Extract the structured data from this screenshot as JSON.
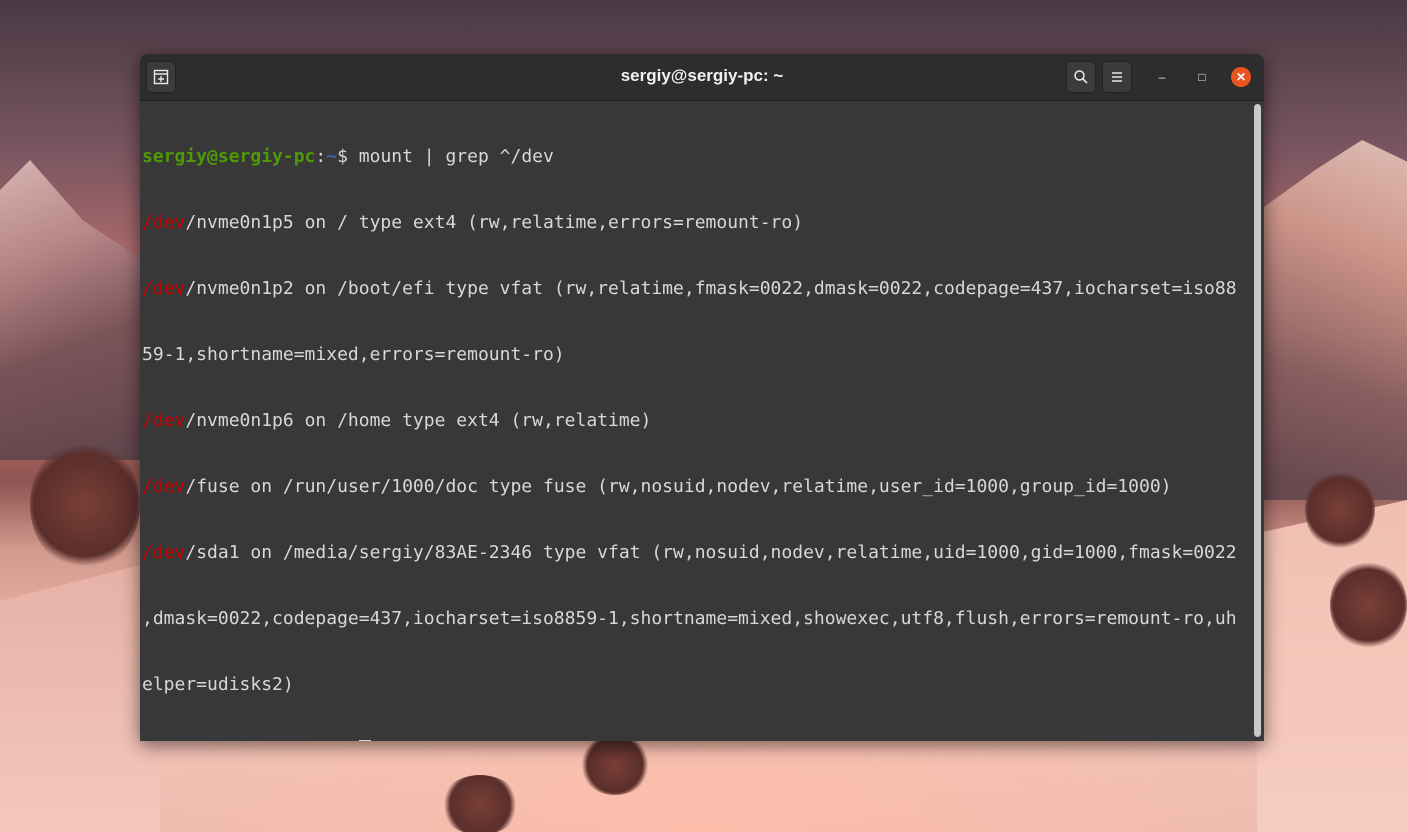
{
  "window": {
    "title": "sergiy@sergiy-pc: ~",
    "buttons": {
      "new_tab_icon": "new-tab-icon",
      "search_icon": "search-icon",
      "menu_icon": "hamburger-menu-icon",
      "minimize_glyph": "–",
      "maximize_glyph": "□",
      "close_glyph": "✕"
    }
  },
  "terminal": {
    "prompt": {
      "user_host": "sergiy@sergiy-pc",
      "sep": ":",
      "path": "~",
      "dollar": "$ "
    },
    "command": "mount | grep ^/dev",
    "output": [
      {
        "match": "/dev",
        "rest": "/nvme0n1p5 on / type ext4 (rw,relatime,errors=remount-ro)"
      },
      {
        "match": "/dev",
        "rest": "/nvme0n1p2 on /boot/efi type vfat (rw,relatime,fmask=0022,dmask=0022,codepage=437,iocharset=iso88"
      },
      {
        "match": "",
        "rest": "59-1,shortname=mixed,errors=remount-ro)"
      },
      {
        "match": "/dev",
        "rest": "/nvme0n1p6 on /home type ext4 (rw,relatime)"
      },
      {
        "match": "/dev",
        "rest": "/fuse on /run/user/1000/doc type fuse (rw,nosuid,nodev,relatime,user_id=1000,group_id=1000)"
      },
      {
        "match": "/dev",
        "rest": "/sda1 on /media/sergiy/83AE-2346 type vfat (rw,nosuid,nodev,relatime,uid=1000,gid=1000,fmask=0022"
      },
      {
        "match": "",
        "rest": ",dmask=0022,codepage=437,iocharset=iso8859-1,shortname=mixed,showexec,utf8,flush,errors=remount-ro,uh"
      },
      {
        "match": "",
        "rest": "elper=udisks2)"
      }
    ]
  },
  "colors": {
    "prompt_user": "#4e9a06",
    "prompt_path": "#3465a4",
    "grep_match": "#cc0000",
    "terminal_bg": "#383838",
    "close_button": "#e95420"
  }
}
